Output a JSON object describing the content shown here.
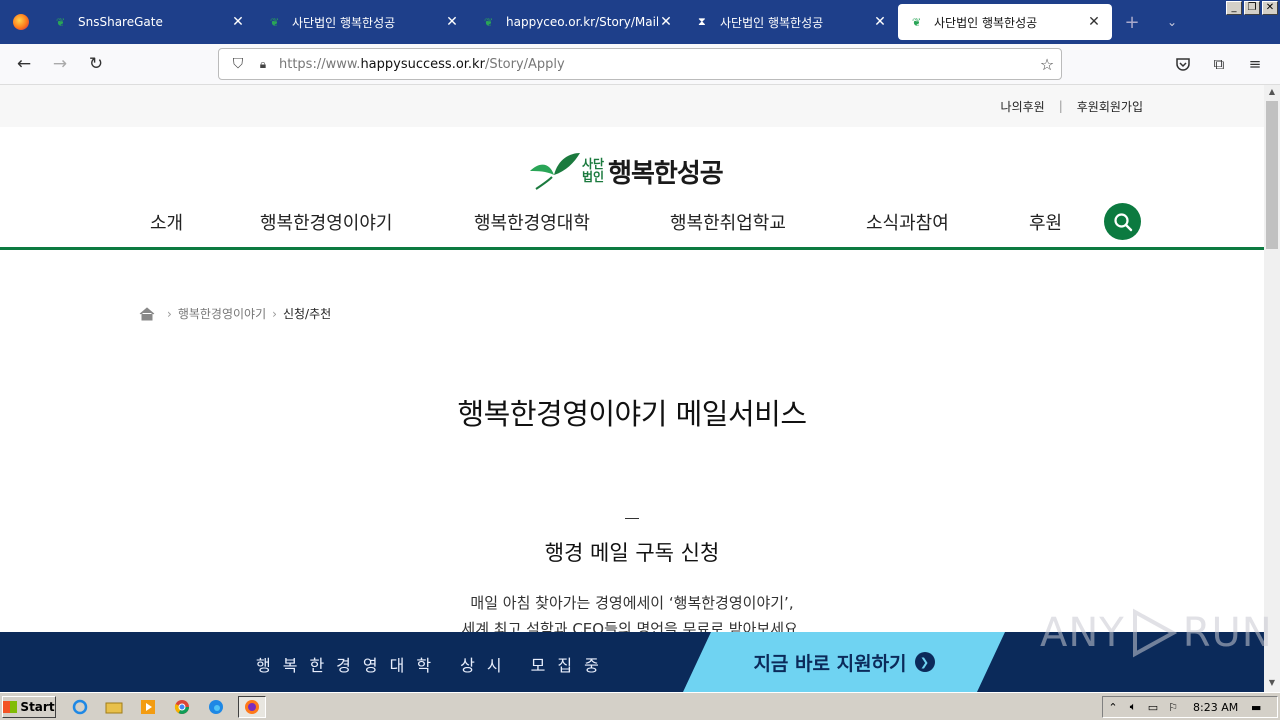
{
  "browser": {
    "tabs": [
      {
        "title": "SnsShareGate",
        "fav": "leaf-icon",
        "active": false
      },
      {
        "title": "사단법인 행복한성공",
        "fav": "leaf-icon",
        "active": false
      },
      {
        "title": "happyceo.or.kr/Story/MailView?i",
        "fav": "leaf-icon",
        "active": false
      },
      {
        "title": "사단법인 행복한성공",
        "fav": "hourglass-icon",
        "active": false
      },
      {
        "title": "사단법인 행복한성공",
        "fav": "leaf-icon",
        "active": true
      }
    ],
    "url_prefix": "https://www.",
    "url_domain": "happysuccess.or.kr",
    "url_path": "/Story/Apply"
  },
  "site": {
    "util_links": [
      "나의후원",
      "후원회원가입"
    ],
    "logo_small_line1": "사단",
    "logo_small_line2": "법인",
    "logo_big": "행복한성공",
    "menu": [
      "소개",
      "행복한경영이야기",
      "행복한경영대학",
      "행복한취업학교",
      "소식과참여",
      "후원"
    ],
    "breadcrumb": [
      "행복한경영이야기",
      "신청/추천"
    ],
    "page_title": "행복한경영이야기 메일서비스",
    "sub_title": "행경 메일 구독 신청",
    "desc_line1": "매일 아침 찾아가는 경영에세이 ‘행복한경영이야기’,",
    "desc_line2": "세계 최고 석학과 CEO들의 명언을 무료로 받아보세요."
  },
  "banner": {
    "promo": "행복한경영대학 상시 모집중",
    "cta": "지금 바로 지원하기"
  },
  "watermark": {
    "left": "ANY",
    "right": "RUN"
  },
  "taskbar": {
    "start": "Start",
    "clock": "8:23 AM"
  },
  "colors": {
    "brand_green": "#0c7a40",
    "banner_navy": "#0b2a5a",
    "cta_cyan": "#6fd3f2",
    "tab_bar": "#1e3f8a"
  }
}
